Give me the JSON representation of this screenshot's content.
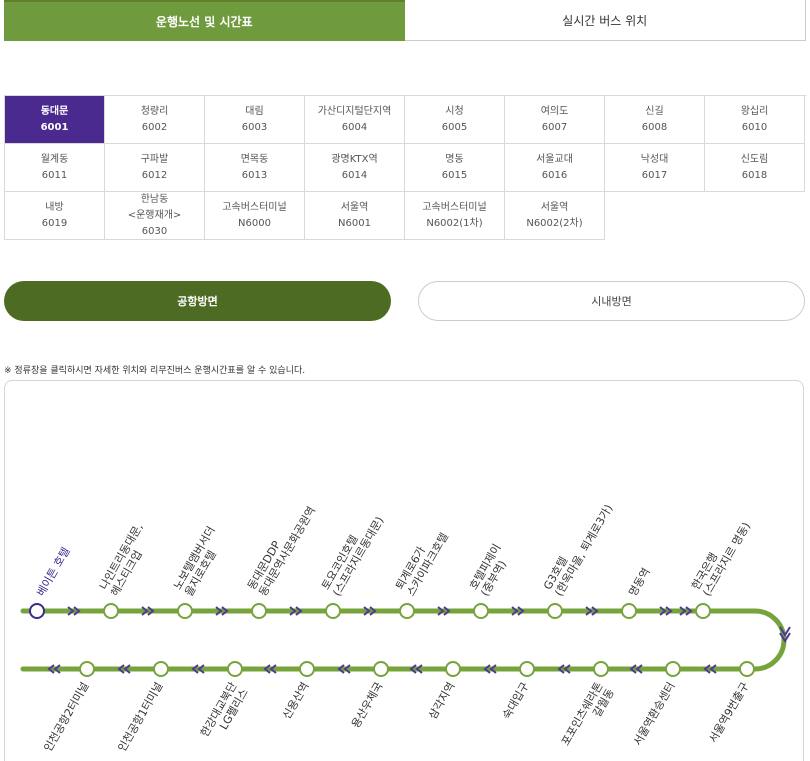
{
  "top_tabs": [
    {
      "label": "운행노선 및 시간표",
      "active": true
    },
    {
      "label": "실시간 버스 위치",
      "active": false
    }
  ],
  "routes": [
    {
      "name": "동대문",
      "code": "6001",
      "active": true
    },
    {
      "name": "청량리",
      "code": "6002"
    },
    {
      "name": "대림",
      "code": "6003"
    },
    {
      "name": "가산디지털단지역",
      "code": "6004"
    },
    {
      "name": "시청",
      "code": "6005"
    },
    {
      "name": "여의도",
      "code": "6007"
    },
    {
      "name": "신길",
      "code": "6008"
    },
    {
      "name": "왕십리",
      "code": "6010"
    },
    {
      "name": "월계동",
      "code": "6011"
    },
    {
      "name": "구파발",
      "code": "6012"
    },
    {
      "name": "면목동",
      "code": "6013"
    },
    {
      "name": "광명KTX역",
      "code": "6014"
    },
    {
      "name": "명동",
      "code": "6015"
    },
    {
      "name": "서울교대",
      "code": "6016"
    },
    {
      "name": "낙성대",
      "code": "6017"
    },
    {
      "name": "신도림",
      "code": "6018"
    },
    {
      "name": "내방",
      "code": "6019"
    },
    {
      "name": "한남동\n<운행재개>",
      "code": "6030"
    },
    {
      "name": "고속버스터미널",
      "code": "N6000"
    },
    {
      "name": "서울역",
      "code": "N6001"
    },
    {
      "name": "고속버스터미널",
      "code": "N6002(1차)"
    },
    {
      "name": "서울역",
      "code": "N6002(2차)"
    }
  ],
  "direction": {
    "airport_label": "공항방면",
    "city_label": "시내방면"
  },
  "notice": "※ 정류장을 클릭하시면 자세한 위치와 리무진버스 운행시간표를 알 수 있습니다.",
  "colors": {
    "line": "#76a33b",
    "arrow": "#4b3a90",
    "current": "#3b2a8a",
    "tab_active": "#6f9a3d",
    "route_active": "#4b2a90",
    "dir_active": "#4d6b22"
  },
  "stops_top": [
    {
      "label": "베이튼 호텔",
      "current": true
    },
    {
      "label": "나인트리동대문,\n헤스티크업"
    },
    {
      "label": "노보텔앰버서더\n을지로호텔"
    },
    {
      "label": "동대문DDP\n동대문역사문화공원역"
    },
    {
      "label": "토요코인호텔\n(스프라지르동대문)"
    },
    {
      "label": "퇴계로6가\n스카이파크호텔"
    },
    {
      "label": "호텔피제이\n(중부역)"
    },
    {
      "label": "G3호텔\n(한옥마을, 퇴계로3가)"
    },
    {
      "label": "명동역"
    },
    {
      "label": "한국은행\n(스프라지르 명동)"
    }
  ],
  "stops_bottom": [
    {
      "label": "인천공항2터미널"
    },
    {
      "label": "인천공항1터미널"
    },
    {
      "label": "한강대교북단\nLG펠리스"
    },
    {
      "label": "신용산역"
    },
    {
      "label": "용산우체국"
    },
    {
      "label": "삼각지역"
    },
    {
      "label": "숙대입구"
    },
    {
      "label": "포포인츠쉐라톤\n갈월동"
    },
    {
      "label": "서울역환승센터"
    },
    {
      "label": "서울역9번출구"
    }
  ]
}
